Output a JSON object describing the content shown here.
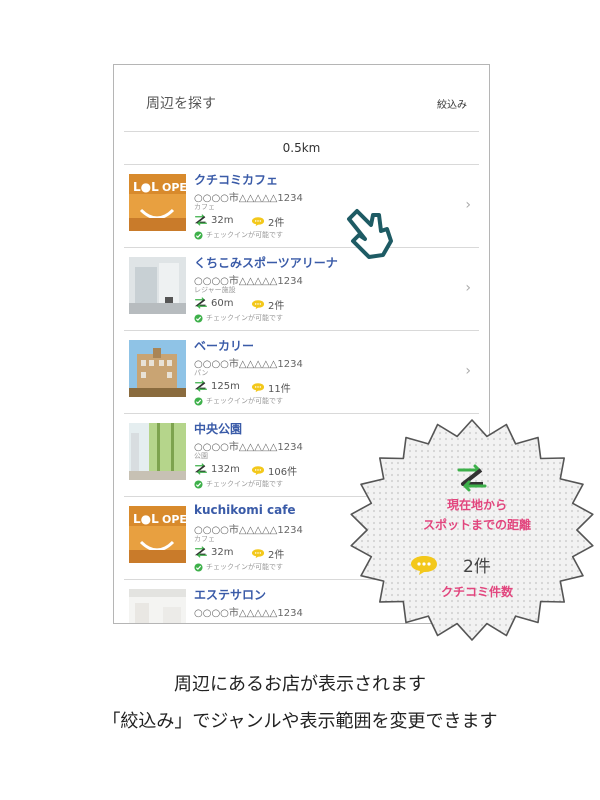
{
  "header": {
    "title": "周辺を探す",
    "filter_label": "絞込み"
  },
  "range": {
    "value": "0.5km"
  },
  "items": [
    {
      "name": "クチコミカフェ",
      "address": "○○○○市△△△△△1234",
      "category": "カフェ",
      "distance": "32m",
      "count": "2件",
      "checkin": "チェックインが可能です",
      "thumb": "cafe"
    },
    {
      "name": "くちこみスポーツアリーナ",
      "address": "○○○○市△△△△△1234",
      "category": "レジャー施設",
      "distance": "60m",
      "count": "2件",
      "checkin": "チェックインが可能です",
      "thumb": "arena"
    },
    {
      "name": "ベーカリー",
      "address": "○○○○市△△△△△1234",
      "category": "パン",
      "distance": "125m",
      "count": "11件",
      "checkin": "チェックインが可能です",
      "thumb": "bakery"
    },
    {
      "name": "中央公園",
      "address": "○○○○市△△△△△1234",
      "category": "公園",
      "distance": "132m",
      "count": "106件",
      "checkin": "チェックインが可能です",
      "thumb": "park"
    },
    {
      "name": "kuchikomi cafe",
      "address": "○○○○市△△△△△1234",
      "category": "カフェ",
      "distance": "32m",
      "count": "2件",
      "checkin": "チェックインが可能です",
      "thumb": "cafe"
    },
    {
      "name": "エステサロン",
      "address": "○○○○市△△△△△1234",
      "category": "",
      "distance": "",
      "count": "",
      "checkin": "",
      "thumb": "salon"
    }
  ],
  "callout": {
    "distance_label_line1": "現在地から",
    "distance_label_line2": "スポットまでの距離",
    "count_example": "2件",
    "count_label": "クチコミ件数"
  },
  "captions": {
    "line1": "周辺にあるお店が表示されます",
    "line2": "「絞込み」でジャンルや表示範囲を変更できます"
  },
  "colors": {
    "accent_blue": "#3a5ba8",
    "pink": "#e2467e",
    "green": "#3db04a",
    "yellow": "#f3c81b",
    "teal": "#1e5b64"
  }
}
